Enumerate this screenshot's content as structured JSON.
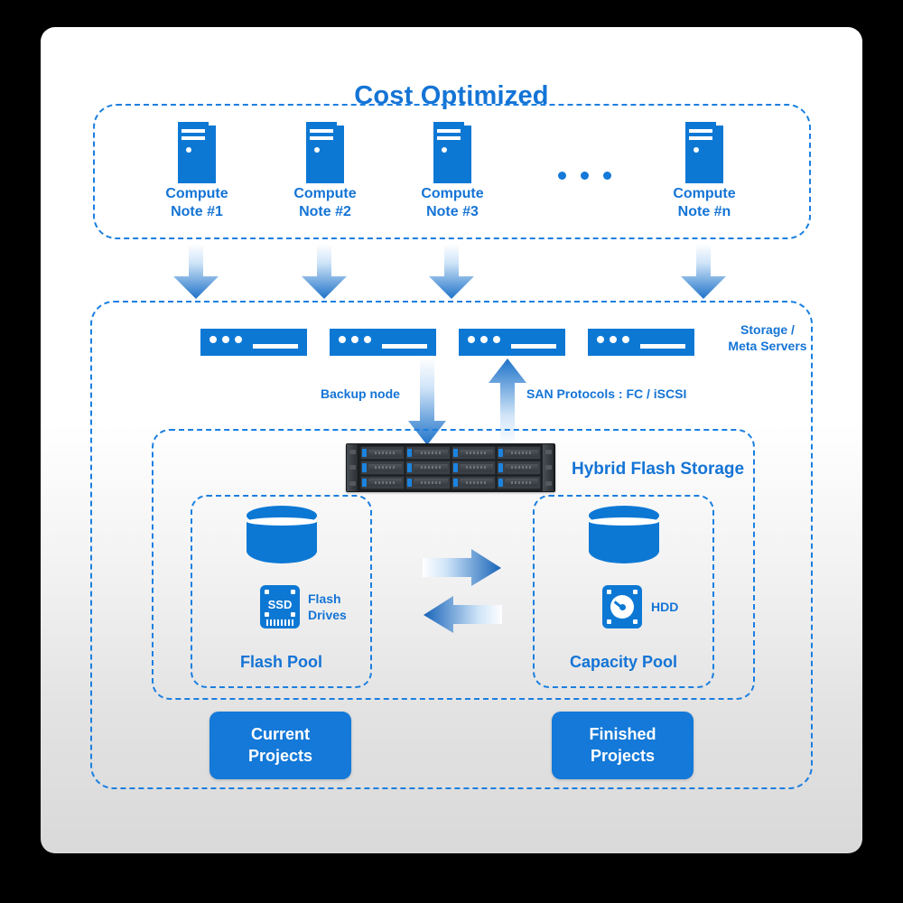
{
  "diagram": {
    "title": "Cost Optimized",
    "accent_color": "#1479d8",
    "icon_blue": "#0d78d4",
    "card_bg_top": "#ffffff",
    "card_bg_bottom": "#d9d9d9"
  },
  "compute_tier": {
    "nodes": [
      {
        "icon": "server-tower-icon",
        "label_line1": "Compute",
        "label_line2": "Note #1"
      },
      {
        "icon": "server-tower-icon",
        "label_line1": "Compute",
        "label_line2": "Note #2"
      },
      {
        "icon": "server-tower-icon",
        "label_line1": "Compute",
        "label_line2": "Note #3"
      },
      {
        "icon": "server-tower-icon",
        "label_line1": "Compute",
        "label_line2": "Note #n"
      }
    ],
    "ellipsis": "• • •"
  },
  "storage_tier": {
    "servers_label_line1": "Storage /",
    "servers_label_line2": "Meta Servers",
    "server_count": 4,
    "server_icon": "rack-server-icon",
    "backup_node_label": "Backup node",
    "san_protocols_label": "SAN Protocols : FC / iSCSI"
  },
  "hybrid_flash_storage": {
    "title": "Hybrid Flash Storage",
    "chassis_icon": "disk-array-chassis-icon",
    "chassis_bays": 12,
    "flash_pool": {
      "title": "Flash Pool",
      "cylinder_icon": "database-cylinder-icon",
      "drive_icon": "ssd-icon",
      "drive_icon_text": "SSD",
      "drive_label_line1": "Flash",
      "drive_label_line2": "Drives"
    },
    "capacity_pool": {
      "title": "Capacity Pool",
      "cylinder_icon": "database-cylinder-icon",
      "drive_icon": "hdd-icon",
      "drive_label": "HDD"
    },
    "tiering_arrows": {
      "right_arrow": "arrow-right-icon",
      "left_arrow": "arrow-left-icon"
    }
  },
  "projects": {
    "current": {
      "line1": "Current",
      "line2": "Projects"
    },
    "finished": {
      "line1": "Finished",
      "line2": "Projects"
    }
  }
}
